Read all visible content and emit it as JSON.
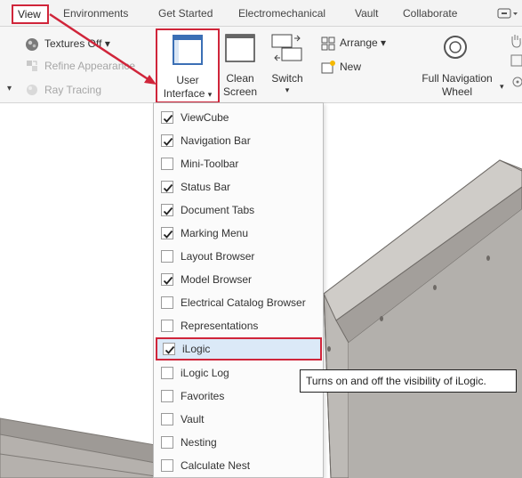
{
  "tabs": [
    {
      "label": "View",
      "active": true
    },
    {
      "label": "Environments"
    },
    {
      "label": "Get Started"
    },
    {
      "label": "Electromechanical"
    },
    {
      "label": "Vault"
    },
    {
      "label": "Collaborate"
    }
  ],
  "ribbon": {
    "textures_off": "Textures Off",
    "refine_appearance": "Refine Appearance",
    "ray_tracing": "Ray Tracing",
    "user_interface_line1": "User",
    "user_interface_line2": "Interface",
    "clean_screen_line1": "Clean",
    "clean_screen_line2": "Screen",
    "switch_label": "Switch",
    "arrange_label": "Arrange",
    "new_label": "New",
    "full_nav_line1": "Full Navigation",
    "full_nav_line2": "Wheel"
  },
  "menu": {
    "items": [
      {
        "label": "ViewCube",
        "checked": true
      },
      {
        "label": "Navigation Bar",
        "checked": true
      },
      {
        "label": "Mini-Toolbar",
        "checked": false
      },
      {
        "label": "Status Bar",
        "checked": true
      },
      {
        "label": "Document Tabs",
        "checked": true
      },
      {
        "label": "Marking Menu",
        "checked": true
      },
      {
        "label": "Layout Browser",
        "checked": false
      },
      {
        "label": "Model Browser",
        "checked": true
      },
      {
        "label": "Electrical Catalog Browser",
        "checked": false
      },
      {
        "label": "Representations",
        "checked": false
      },
      {
        "label": "iLogic",
        "checked": true,
        "highlighted": true
      },
      {
        "label": "iLogic Log",
        "checked": false
      },
      {
        "label": "Favorites",
        "checked": false
      },
      {
        "label": "Vault",
        "checked": false
      },
      {
        "label": "Nesting",
        "checked": false
      },
      {
        "label": "Calculate Nest",
        "checked": false
      }
    ]
  },
  "tooltip": "Turns on and off the visibility of iLogic.",
  "colors": {
    "annotation_red": "#d0253a",
    "highlight_blue": "#dbe9f7",
    "model_gray": "#b5b1ad"
  }
}
